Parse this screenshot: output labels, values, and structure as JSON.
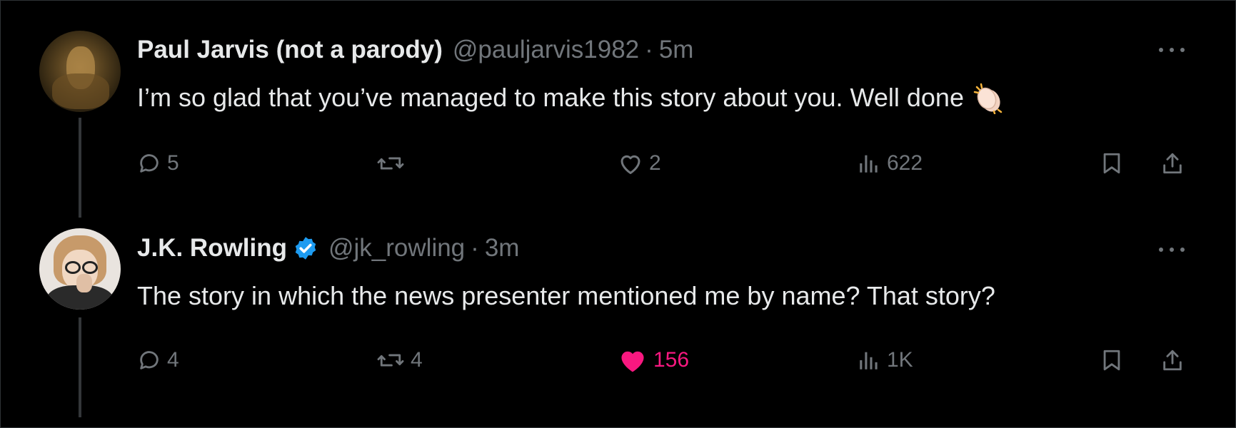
{
  "tweets": [
    {
      "name": "Paul Jarvis (not a parody)",
      "handle": "@pauljarvis1982",
      "separator": "·",
      "time": "5m",
      "text": "I’m so glad that you’ve managed to make this story about you. Well done",
      "emoji": "clapping-hands-icon",
      "verified": false,
      "actions": {
        "replies": "5",
        "retweets": "",
        "likes": "2",
        "views": "622",
        "liked": false
      }
    },
    {
      "name": "J.K. Rowling",
      "handle": "@jk_rowling",
      "separator": "·",
      "time": "3m",
      "text": "The story in which the news presenter mentioned me by name? That story?",
      "verified": true,
      "actions": {
        "replies": "4",
        "retweets": "4",
        "likes": "156",
        "views": "1K",
        "liked": true
      }
    }
  ],
  "colors": {
    "background": "#000000",
    "text": "#e7e9ea",
    "muted": "#71767b",
    "like": "#f91880",
    "verified": "#1d9bf0"
  }
}
